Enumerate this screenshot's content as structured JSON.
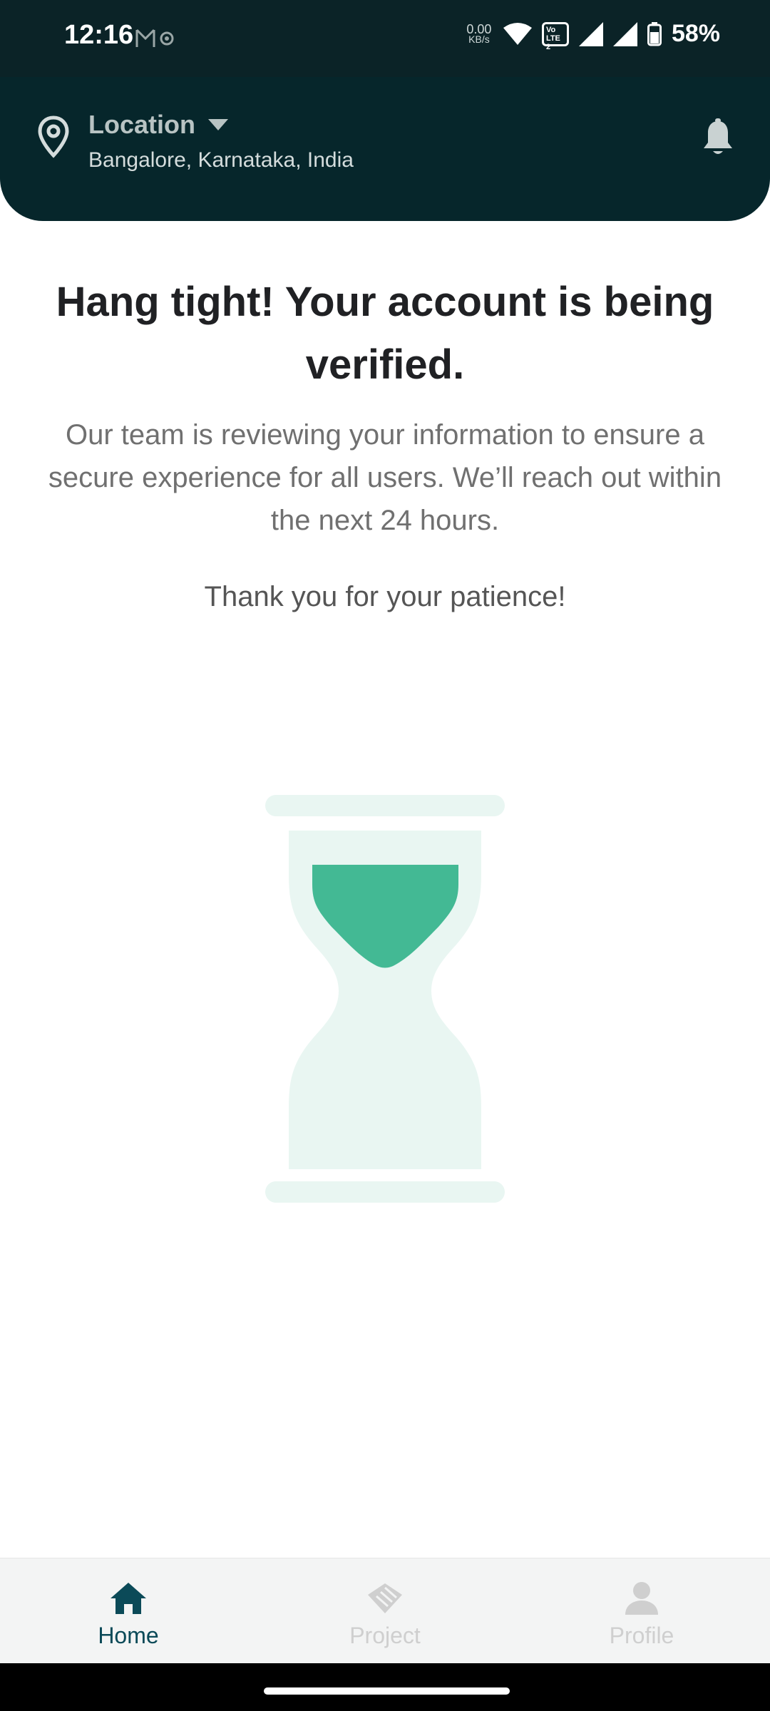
{
  "status_bar": {
    "time": "12:16",
    "data_rate_value": "0.00",
    "data_rate_unit": "KB/s",
    "volte_label": "Vo LTE",
    "volte_sim": "2",
    "battery_percent": "58%"
  },
  "header": {
    "location_label": "Location",
    "location_value": "Bangalore, Karnataka, India",
    "bg_color": "#06262b"
  },
  "main": {
    "title": "Hang tight! Your account is being verified.",
    "description": "Our team is reviewing your information to ensure a secure experience for all users. We’ll reach out within the next 24 hours.",
    "thanks": "Thank you for your patience!",
    "illustration": "hourglass-icon",
    "accent_color": "#43b994",
    "illustration_bg": "#e9f6f2"
  },
  "bottom_nav": {
    "items": [
      {
        "label": "Home",
        "icon": "home-icon",
        "active": true
      },
      {
        "label": "Project",
        "icon": "handshake-icon",
        "active": false
      },
      {
        "label": "Profile",
        "icon": "person-icon",
        "active": false
      }
    ],
    "active_color": "#0b4a58",
    "inactive_color": "#cfcfcf"
  }
}
